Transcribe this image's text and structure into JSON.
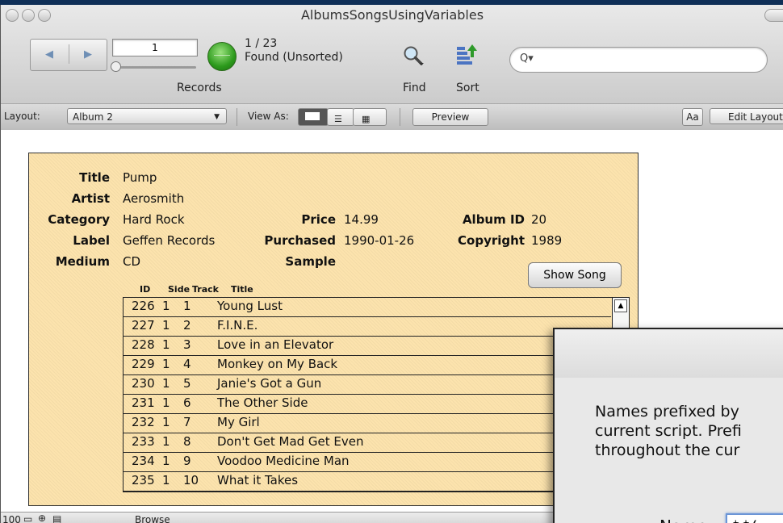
{
  "window": {
    "title": "AlbumsSongsUsingVariables"
  },
  "toolbar": {
    "record_number": "1",
    "record_count": "1 / 23",
    "found_status": "Found (Unsorted)",
    "records_label": "Records",
    "find_label": "Find",
    "sort_label": "Sort",
    "search_placeholder": ""
  },
  "layout_bar": {
    "layout_label": "Layout:",
    "layout_value": "Album 2",
    "view_as_label": "View As:",
    "preview_label": "Preview",
    "aa_label": "Aa",
    "edit_layout_label": "Edit Layout"
  },
  "record": {
    "title_label": "Title",
    "title_value": "Pump",
    "artist_label": "Artist",
    "artist_value": "Aerosmith",
    "category_label": "Category",
    "category_value": "Hard Rock",
    "price_label": "Price",
    "price_value": "14.99",
    "album_id_label": "Album ID",
    "album_id_value": "20",
    "label_label": "Label",
    "label_value": "Geffen Records",
    "purchased_label": "Purchased",
    "purchased_value": "1990-01-26",
    "copyright_label": "Copyright",
    "copyright_value": "1989",
    "medium_label": "Medium",
    "medium_value": "CD",
    "sample_label": "Sample",
    "show_song_label": "Show Song"
  },
  "songs": {
    "headers": [
      "ID",
      "Side",
      "Track",
      "Title"
    ],
    "rows": [
      {
        "id": "226",
        "side": "1",
        "track": "1",
        "title": "Young Lust"
      },
      {
        "id": "227",
        "side": "1",
        "track": "2",
        "title": "F.I.N.E."
      },
      {
        "id": "228",
        "side": "1",
        "track": "3",
        "title": "Love in an Elevator"
      },
      {
        "id": "229",
        "side": "1",
        "track": "4",
        "title": "Monkey on My Back"
      },
      {
        "id": "230",
        "side": "1",
        "track": "5",
        "title": "Janie's Got a Gun"
      },
      {
        "id": "231",
        "side": "1",
        "track": "6",
        "title": "The Other Side"
      },
      {
        "id": "232",
        "side": "1",
        "track": "7",
        "title": "My Girl"
      },
      {
        "id": "233",
        "side": "1",
        "track": "8",
        "title": "Don't Get Mad Get Even"
      },
      {
        "id": "234",
        "side": "1",
        "track": "9",
        "title": "Voodoo Medicine Man"
      },
      {
        "id": "235",
        "side": "1",
        "track": "10",
        "title": "What it Takes"
      }
    ]
  },
  "statusbar": {
    "zoom": "100",
    "mode": "Browse"
  },
  "dialog": {
    "line1": "Names prefixed by",
    "line2": "current script. Prefi",
    "line3": "throughout the cur",
    "name_label": "Name:",
    "name_value": "$$("
  },
  "colors": {
    "record_background": "#fce3ad",
    "record_button_green": "#2c9a1c",
    "desktop_blue": "#12365f"
  }
}
